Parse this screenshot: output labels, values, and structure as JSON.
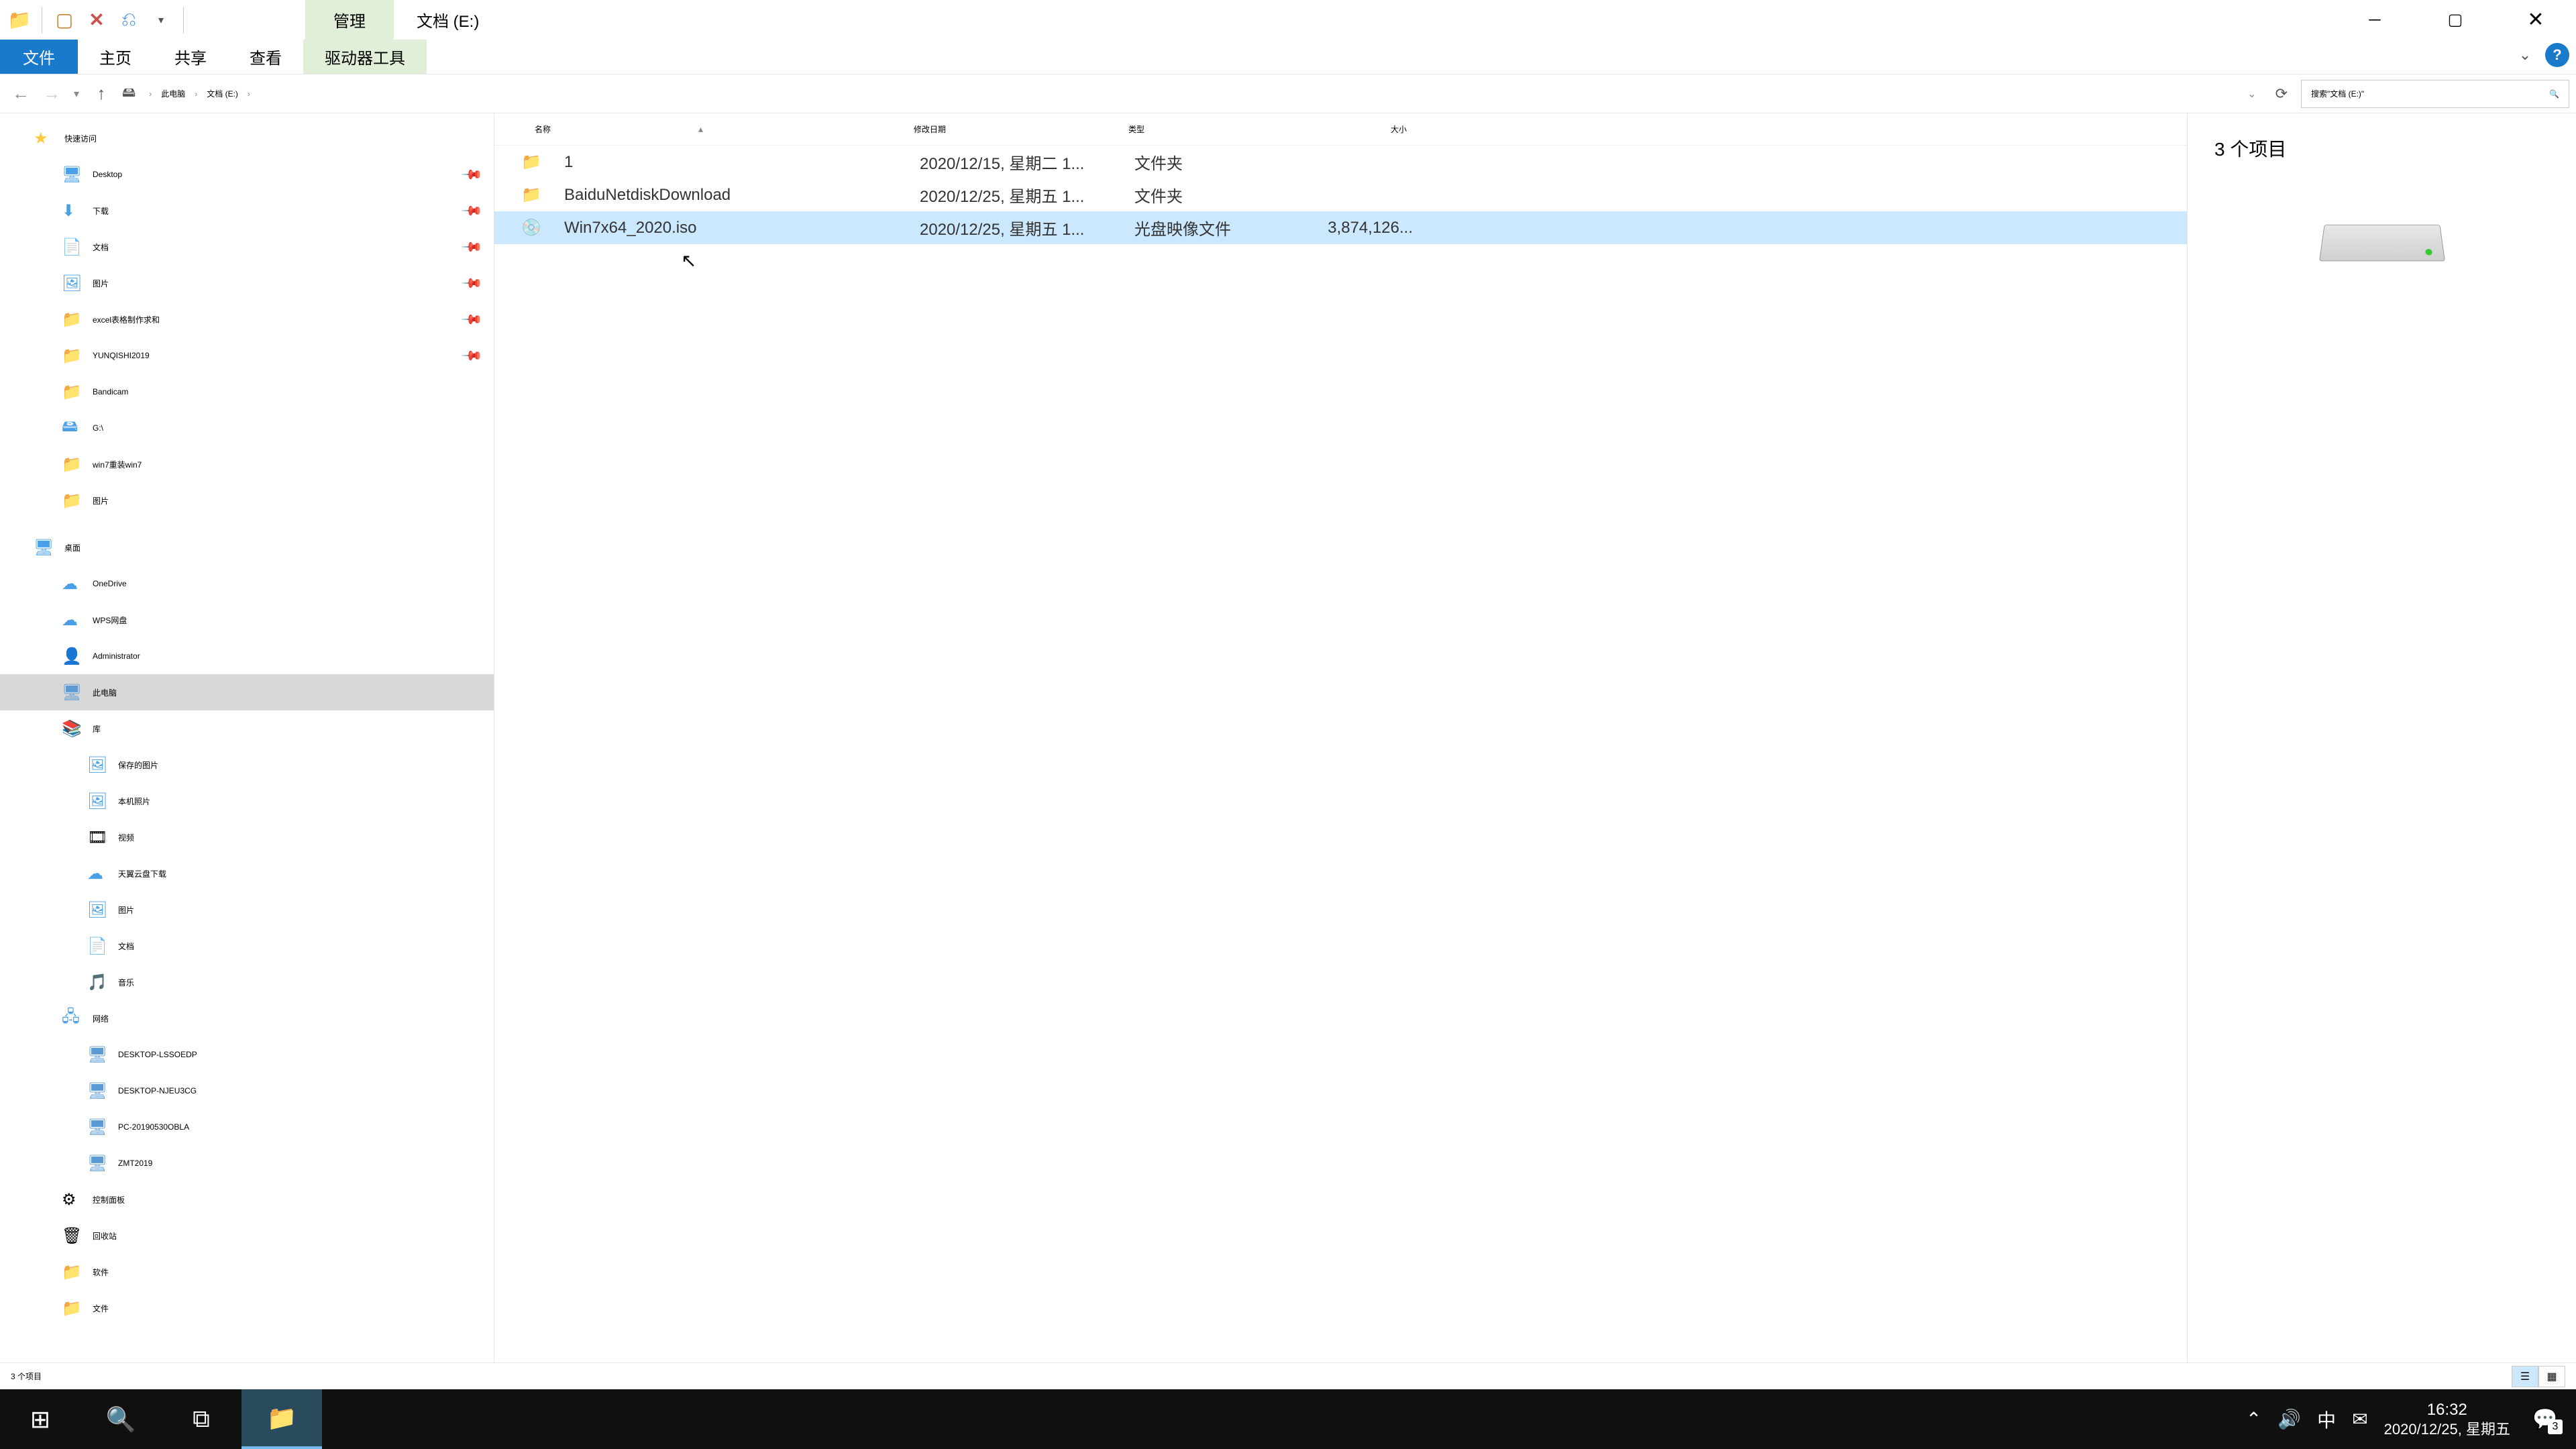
{
  "titlebar": {
    "context_tab": "管理",
    "window_title": "文档 (E:)"
  },
  "ribbon": {
    "file": "文件",
    "home": "主页",
    "share": "共享",
    "view": "查看",
    "drive_tools": "驱动器工具"
  },
  "breadcrumb": {
    "seg1": "此电脑",
    "seg2": "文档 (E:)"
  },
  "search": {
    "placeholder": "搜索\"文档 (E:)\""
  },
  "nav": {
    "quick_access": "快速访问",
    "desktop": "Desktop",
    "downloads": "下载",
    "documents": "文档",
    "pictures": "图片",
    "excel": "excel表格制作求和",
    "yunqishi": "YUNQISHI2019",
    "bandicam": "Bandicam",
    "gdrive": "G:\\",
    "win7reinstall": "win7重装win7",
    "pictures2": "图片",
    "desktop2": "桌面",
    "onedrive": "OneDrive",
    "wps": "WPS网盘",
    "admin": "Administrator",
    "thispc": "此电脑",
    "libraries": "库",
    "saved_pics": "保存的图片",
    "camera_roll": "本机照片",
    "videos": "视频",
    "tianyi": "天翼云盘下载",
    "pictures3": "图片",
    "documents2": "文档",
    "music": "音乐",
    "network": "网络",
    "desk_lss": "DESKTOP-LSSOEDP",
    "desk_nje": "DESKTOP-NJEU3CG",
    "pc2019": "PC-20190530OBLA",
    "zmt": "ZMT2019",
    "control_panel": "控制面板",
    "recycle": "回收站",
    "software": "软件",
    "files": "文件"
  },
  "columns": {
    "name": "名称",
    "date": "修改日期",
    "type": "类型",
    "size": "大小"
  },
  "rows": [
    {
      "name": "1",
      "date": "2020/12/15, 星期二 1...",
      "type": "文件夹",
      "size": "",
      "icon": "folder"
    },
    {
      "name": "BaiduNetdiskDownload",
      "date": "2020/12/25, 星期五 1...",
      "type": "文件夹",
      "size": "",
      "icon": "folder"
    },
    {
      "name": "Win7x64_2020.iso",
      "date": "2020/12/25, 星期五 1...",
      "type": "光盘映像文件",
      "size": "3,874,126...",
      "icon": "file"
    }
  ],
  "preview": {
    "count": "3 个项目"
  },
  "status": {
    "text": "3 个项目"
  },
  "tray": {
    "ime": "中",
    "time": "16:32",
    "date": "2020/12/25, 星期五",
    "notif_count": "3"
  }
}
